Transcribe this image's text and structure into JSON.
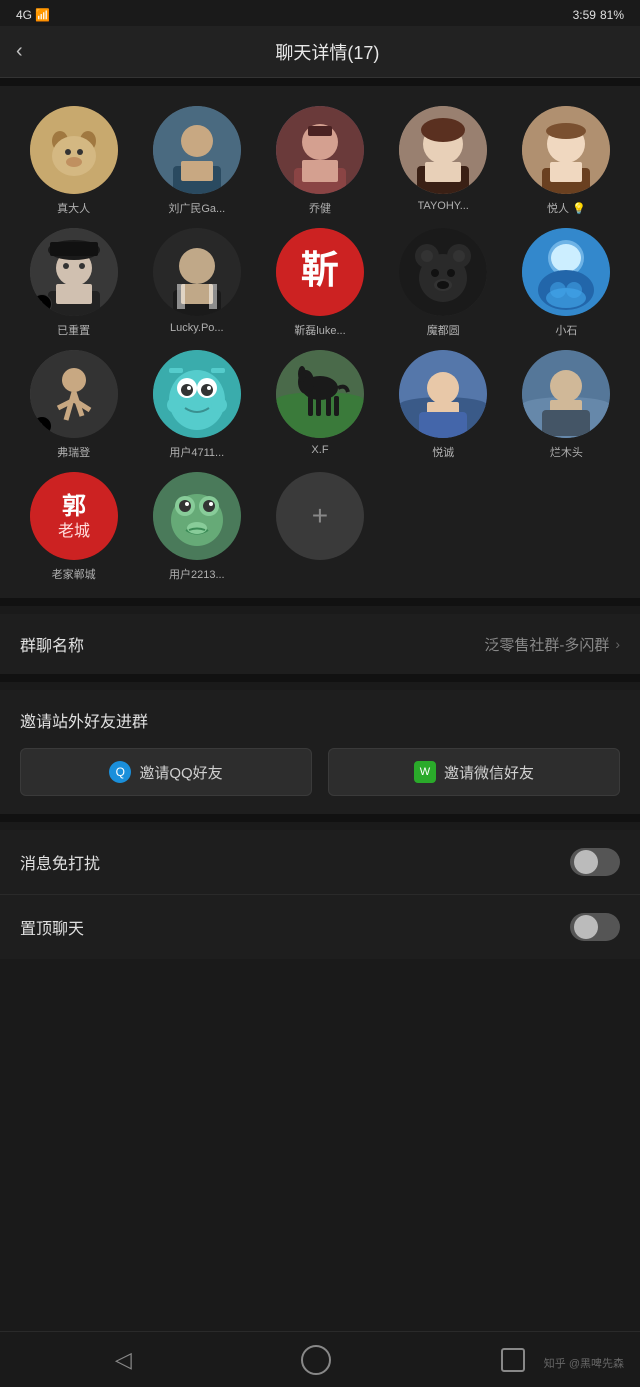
{
  "statusBar": {
    "left": "4G",
    "time": "3:59",
    "battery": "81%"
  },
  "header": {
    "backLabel": "‹",
    "title": "聊天详情(17)"
  },
  "members": [
    {
      "name": "真大人",
      "avatarType": "dog",
      "hasTiktok": false
    },
    {
      "name": "刘广民Ga...",
      "avatarType": "man1",
      "hasTiktok": false
    },
    {
      "name": "乔健",
      "avatarType": "woman1",
      "hasTiktok": false
    },
    {
      "name": "TAYOHY...",
      "avatarType": "ancient",
      "hasTiktok": false
    },
    {
      "name": "悦人 💡",
      "avatarType": "vintage",
      "hasTiktok": false
    },
    {
      "name": "已重置",
      "avatarType": "hat",
      "hasTiktok": true
    },
    {
      "name": "Lucky.Po...",
      "avatarType": "suit",
      "hasTiktok": false
    },
    {
      "name": "靳磊luke...",
      "avatarType": "red",
      "hasTiktok": false
    },
    {
      "name": "魔都圆",
      "avatarType": "bear",
      "hasTiktok": false
    },
    {
      "name": "小石",
      "avatarType": "blue",
      "hasTiktok": false
    },
    {
      "name": "弗瑞登",
      "avatarType": "run",
      "hasTiktok": true
    },
    {
      "name": "用户4711...",
      "avatarType": "teal",
      "hasTiktok": false
    },
    {
      "name": "X.F",
      "avatarType": "horse",
      "hasTiktok": false
    },
    {
      "name": "悦诚",
      "avatarType": "beach",
      "hasTiktok": false
    },
    {
      "name": "烂木头",
      "avatarType": "outdoor",
      "hasTiktok": false
    },
    {
      "name": "老家郸城",
      "avatarType": "guo",
      "hasTiktok": false
    },
    {
      "name": "用户2213...",
      "avatarType": "frog",
      "hasTiktok": false
    }
  ],
  "groupName": {
    "label": "群聊名称",
    "value": "泛零售社群-多闪群"
  },
  "invite": {
    "title": "邀请站外好友进群",
    "qqButton": "邀请QQ好友",
    "wxButton": "邀请微信好友"
  },
  "settings": [
    {
      "label": "消息免打扰",
      "toggle": false
    },
    {
      "label": "置顶聊天",
      "toggle": false
    }
  ],
  "bottomNav": {
    "zhihuTag": "知乎 @黑啤先森"
  }
}
